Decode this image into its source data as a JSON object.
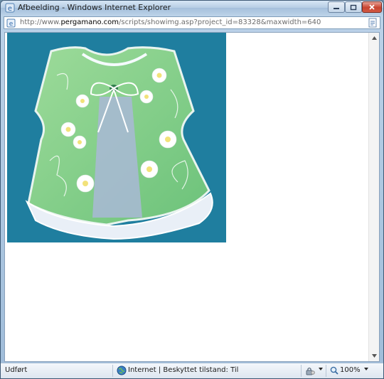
{
  "window": {
    "title": "Afbeelding - Windows Internet Explorer"
  },
  "address": {
    "prefix": "http://www.",
    "domain": "pergamano.com",
    "path": "/scripts/showimg.asp?project_id=83328&maxwidth=640"
  },
  "status": {
    "text": "Udført",
    "zone": "Internet | Beskyttet tilstand: Til",
    "zoom": "100%"
  },
  "icons": {
    "app": "ie-page-icon",
    "security_zone": "globe-icon",
    "protected_mode": "lock-icon",
    "zoom": "magnifier-icon"
  },
  "picture": {
    "description_color": "#1f7e9f"
  }
}
